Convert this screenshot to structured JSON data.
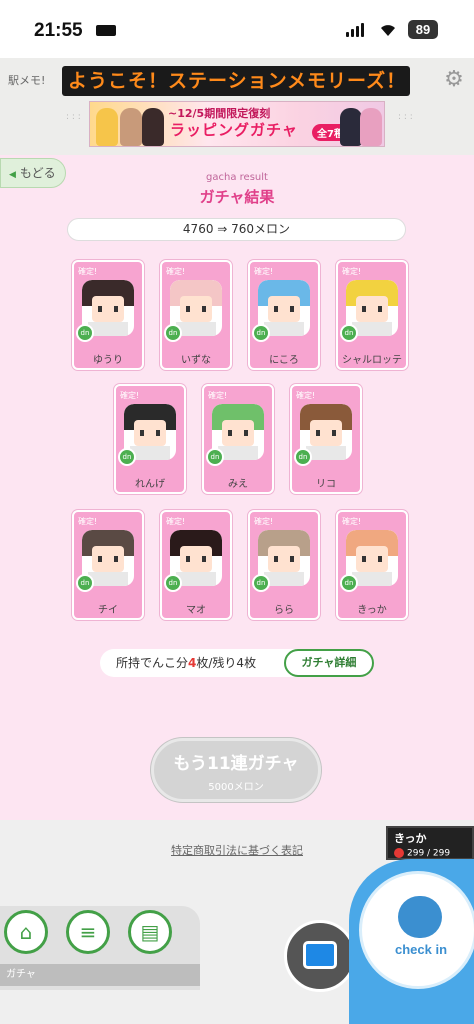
{
  "status_bar": {
    "time": "21:55",
    "battery": "89"
  },
  "header": {
    "logo": "駅メモ!",
    "ticker": "ようこそ！ステーションメモリーズ！",
    "banner_line1": "~12/5期間限定復刻",
    "banner_line2": "ラッピングガチャ",
    "banner_badge": "全7種"
  },
  "page": {
    "back_label": "もどる",
    "subtitle": "gacha result",
    "title": "ガチャ結果",
    "cost_text": "4760 ⇒ 760メロン"
  },
  "results": [
    {
      "tag": "確定!",
      "name": "ゆうり",
      "hair": "#3a2a2a"
    },
    {
      "tag": "確定!",
      "name": "いずな",
      "hair": "#f4c6c6"
    },
    {
      "tag": "確定!",
      "name": "にころ",
      "hair": "#6ab8e8"
    },
    {
      "tag": "確定!",
      "name": "シャルロッテ",
      "hair": "#f2d240"
    },
    {
      "tag": "確定!",
      "name": "れんげ",
      "hair": "#2a2a2a"
    },
    {
      "tag": "確定!",
      "name": "みえ",
      "hair": "#6fc06a"
    },
    {
      "tag": "確定!",
      "name": "リコ",
      "hair": "#8a5a3a"
    },
    {
      "tag": "確定!",
      "name": "チイ",
      "hair": "#5a4a44"
    },
    {
      "tag": "確定!",
      "name": "マオ",
      "hair": "#2a1a1a"
    },
    {
      "tag": "確定!",
      "name": "らら",
      "hair": "#b8a08a"
    },
    {
      "tag": "確定!",
      "name": "きっか",
      "hair": "#f0a880"
    }
  ],
  "ticket": {
    "prefix": "所持でんこ分",
    "owned": "4",
    "mid": "枚/残り",
    "left": "4",
    "suffix": "枚",
    "detail_button": "ガチャ詳細"
  },
  "more_button": {
    "label": "もう11連ガチャ",
    "cost": "5000メロン"
  },
  "footer": {
    "legal_link": "特定商取引法に基づく表記",
    "player_name": "きっか",
    "player_hp": "299 / 299",
    "nav_label": "ガチャ",
    "checkin_label": "check in"
  }
}
